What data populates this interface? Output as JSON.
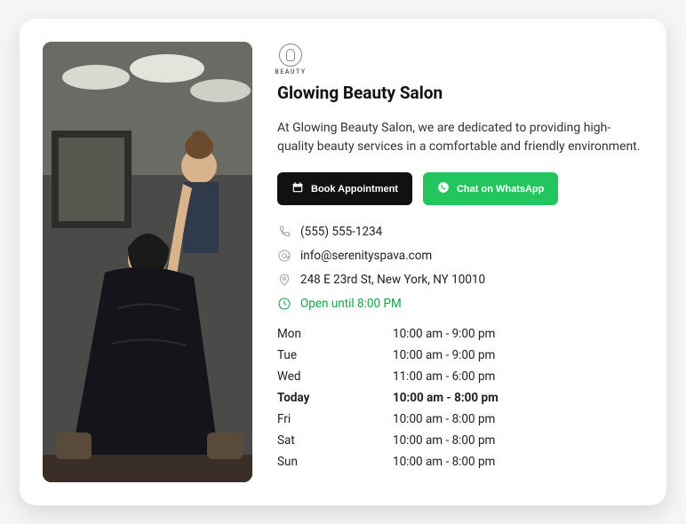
{
  "logo_label": "BEAUTY",
  "title": "Glowing Beauty Salon",
  "description": "At Glowing Beauty Salon, we are dedicated to providing high-quality beauty services in a comfortable and friendly environment.",
  "buttons": {
    "book": "Book Appointment",
    "whatsapp": "Chat on WhatsApp"
  },
  "contact": {
    "phone": "(555) 555-1234",
    "email": "info@serenityspava.com",
    "address": "248 E 23rd St, New York, NY 10010",
    "open_status": "Open until 8:00 PM"
  },
  "hours": [
    {
      "day": "Mon",
      "time": "10:00 am - 9:00 pm",
      "today": false
    },
    {
      "day": "Tue",
      "time": "10:00 am - 9:00 pm",
      "today": false
    },
    {
      "day": "Wed",
      "time": "11:00 am - 6:00 pm",
      "today": false
    },
    {
      "day": "Today",
      "time": "10:00 am - 8:00 pm",
      "today": true
    },
    {
      "day": "Fri",
      "time": "10:00 am - 8:00 pm",
      "today": false
    },
    {
      "day": "Sat",
      "time": "10:00 am - 8:00 pm",
      "today": false
    },
    {
      "day": "Sun",
      "time": "10:00 am - 8:00 pm",
      "today": false
    }
  ]
}
